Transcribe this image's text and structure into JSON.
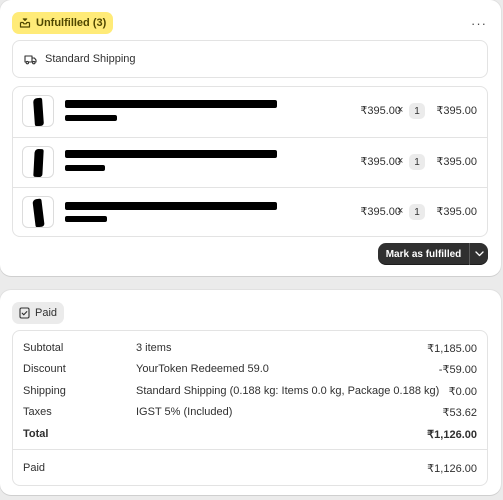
{
  "fulfillment": {
    "status_label": "Unfulfilled (3)",
    "more_label": "···",
    "shipping_method": "Standard Shipping",
    "items": [
      {
        "unit_price": "₹395.00",
        "times": "×",
        "qty": "1",
        "total": "₹395.00"
      },
      {
        "unit_price": "₹395.00",
        "times": "×",
        "qty": "1",
        "total": "₹395.00"
      },
      {
        "unit_price": "₹395.00",
        "times": "×",
        "qty": "1",
        "total": "₹395.00"
      }
    ],
    "action_label": "Mark as fulfilled"
  },
  "payment": {
    "status_label": "Paid",
    "rows": [
      {
        "label": "Subtotal",
        "desc": "3 items",
        "amount": "₹1,185.00"
      },
      {
        "label": "Discount",
        "desc": "YourToken Redeemed 59.0",
        "amount": "-₹59.00"
      },
      {
        "label": "Shipping",
        "desc": "Standard Shipping (0.188 kg: Items 0.0 kg, Package 0.188 kg)",
        "amount": "₹0.00"
      },
      {
        "label": "Taxes",
        "desc": "IGST 5% (Included)",
        "amount": "₹53.62"
      },
      {
        "label": "Total",
        "desc": "",
        "amount": "₹1,126.00"
      }
    ],
    "paid": {
      "label": "Paid",
      "amount": "₹1,126.00"
    }
  },
  "colors": {
    "unfulfilled_badge": "#ffeb78",
    "primary_button": "#303030",
    "page_background": "#ebebeb"
  },
  "icons": [
    "fulfillment-box-icon",
    "truck-icon",
    "paid-receipt-icon",
    "chevron-down-icon"
  ]
}
